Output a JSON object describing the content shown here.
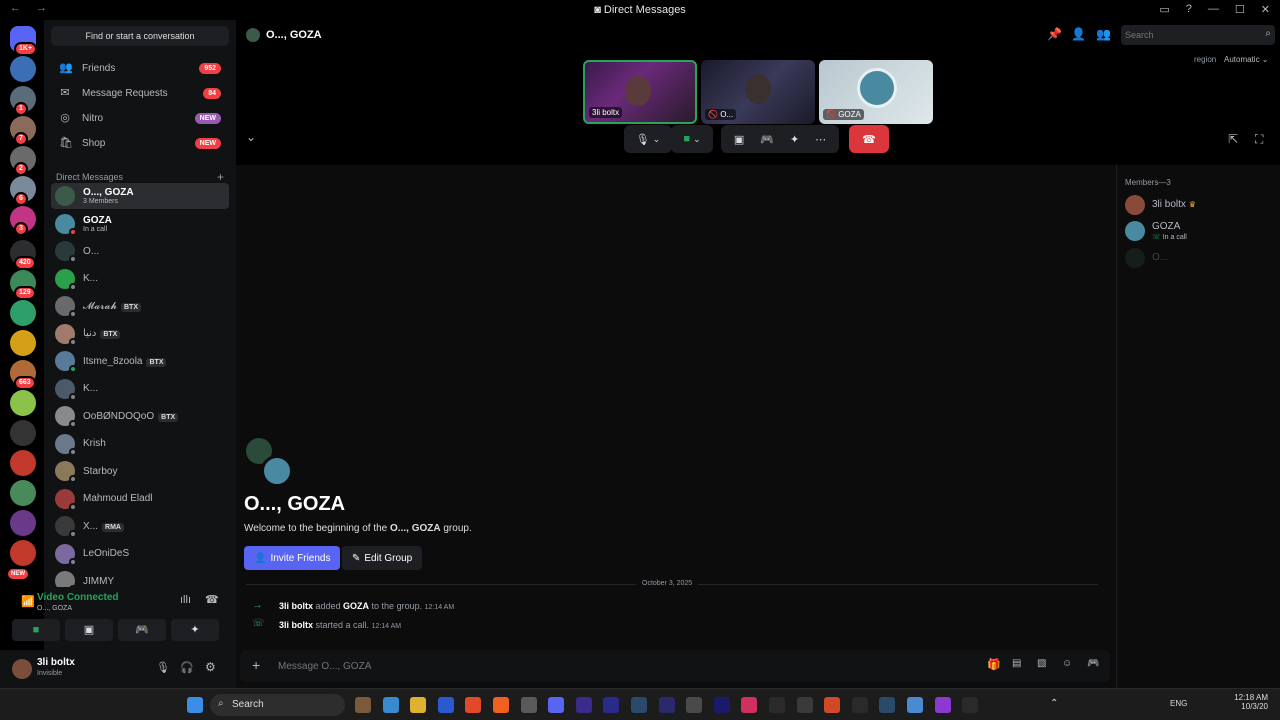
{
  "window": {
    "title": "Direct Messages",
    "nav": "← →"
  },
  "guilds": [
    {
      "badge": "1K+",
      "color": "#5865f2"
    },
    {
      "badge": "",
      "color": "#3b6fb5"
    },
    {
      "badge": "1",
      "color": "#5a6b7a"
    },
    {
      "badge": "7",
      "color": "#8a6a5a"
    },
    {
      "badge": "2",
      "color": "#6a6a6a"
    },
    {
      "badge": "6",
      "color": "#7a8a9a"
    },
    {
      "badge": "3",
      "color": "#c13584"
    },
    {
      "badge": "420",
      "color": "#2b2d31"
    },
    {
      "badge": "129",
      "color": "#3c8a5a"
    },
    {
      "badge": "",
      "color": "#2e9e6b"
    },
    {
      "badge": "",
      "color": "#d4a017"
    },
    {
      "badge": "663",
      "color": "#b06a3a"
    },
    {
      "badge": "",
      "color": "#8bc34a"
    },
    {
      "badge": "",
      "color": "#333"
    },
    {
      "badge": "",
      "color": "#c0392b"
    },
    {
      "badge": "",
      "color": "#4a8a5a"
    },
    {
      "badge": "",
      "color": "#6a3a8a"
    },
    {
      "badge": "",
      "color": "#c0392b"
    }
  ],
  "guild_new": "NEW",
  "dm_search": "Find or start a conversation",
  "nav": [
    {
      "label": "Friends",
      "badge": "952"
    },
    {
      "label": "Message Requests",
      "badge": "84"
    },
    {
      "label": "Nitro",
      "badge": "NEW"
    },
    {
      "label": "Shop",
      "badge": "NEW"
    }
  ],
  "dm_header": "Direct Messages",
  "dms": [
    {
      "name": "O..., GOZA",
      "sub": "3 Members",
      "tag": ""
    },
    {
      "name": "GOZA",
      "sub": "In a call",
      "tag": ""
    },
    {
      "name": "O...",
      "sub": "",
      "tag": ""
    },
    {
      "name": "K...",
      "sub": "",
      "tag": ""
    },
    {
      "name": "𝓜𝓪𝓻𝓪𝓱",
      "sub": "",
      "tag": "BTX"
    },
    {
      "name": "دنيا",
      "sub": "",
      "tag": "BTX"
    },
    {
      "name": "Itsme_8zoola",
      "sub": "",
      "tag": "BTX"
    },
    {
      "name": "K...",
      "sub": "",
      "tag": ""
    },
    {
      "name": "OoBØNDOQoO",
      "sub": "",
      "tag": "BTX"
    },
    {
      "name": "Krish",
      "sub": "",
      "tag": ""
    },
    {
      "name": "Starboy",
      "sub": "",
      "tag": ""
    },
    {
      "name": "Mahmoud Eladl",
      "sub": "",
      "tag": ""
    },
    {
      "name": "X...",
      "sub": "",
      "tag": "RMA"
    },
    {
      "name": "LeOniDeS",
      "sub": "",
      "tag": ""
    },
    {
      "name": "JIMMY",
      "sub": "",
      "tag": ""
    }
  ],
  "voice": {
    "status": "Video Connected",
    "channel": "O..., GOZA"
  },
  "user": {
    "name": "3li boltx",
    "status": "Invisible"
  },
  "header": {
    "channel": "O..., GOZA",
    "search_placeholder": "Search"
  },
  "call": {
    "tiles": [
      {
        "label": "3li boltx"
      },
      {
        "label": "O..."
      },
      {
        "label": "GOZA"
      }
    ],
    "region": "region",
    "region_value": "Automatic"
  },
  "chat": {
    "group_title": "O..., GOZA",
    "welcome_pre": "Welcome to the beginning of the ",
    "welcome_name": "O..., GOZA",
    "welcome_post": " group.",
    "invite": "Invite Friends",
    "edit": "Edit Group",
    "date": "October 3, 2025",
    "messages": [
      {
        "actor": "3li boltx",
        "text1": " added ",
        "target": "GOZA",
        "text2": " to the group.",
        "time": "12:14 AM"
      },
      {
        "actor": "3li boltx",
        "text1": " started a call.",
        "target": "",
        "text2": "",
        "time": "12:14 AM"
      }
    ],
    "input_placeholder": "Message O..., GOZA"
  },
  "members": {
    "header": "Members—3",
    "list": [
      {
        "name": "3li boltx",
        "sub": ""
      },
      {
        "name": "GOZA",
        "sub": "In a call"
      },
      {
        "name": "O...",
        "sub": ""
      }
    ]
  },
  "taskbar": {
    "search": "Search",
    "lang": "ENG",
    "time": "12:18 AM",
    "date": "10/3/20"
  }
}
